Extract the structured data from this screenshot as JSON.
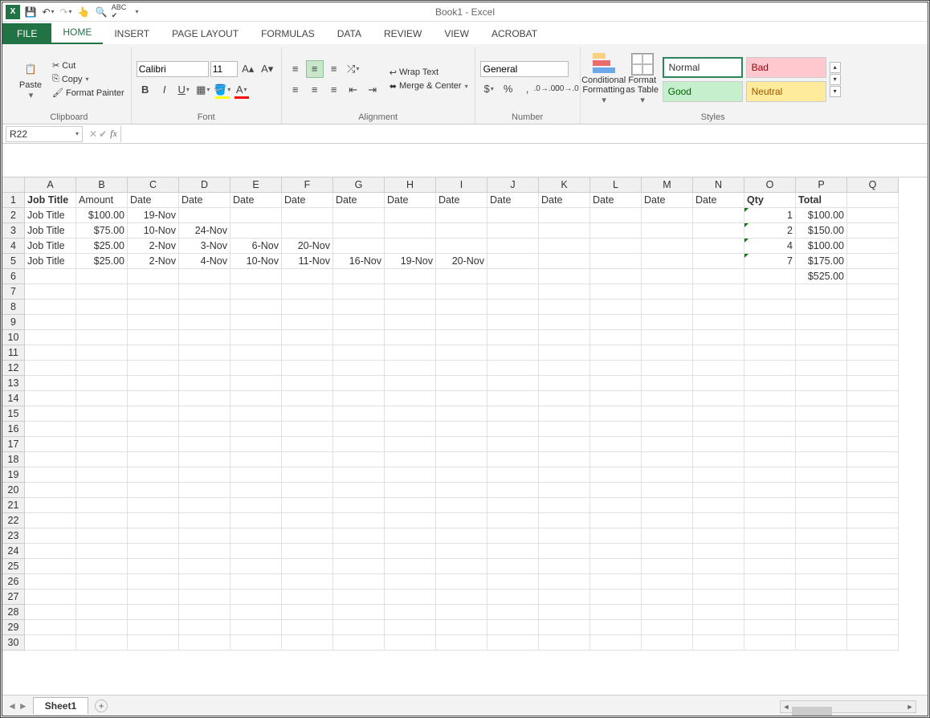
{
  "title": "Book1 - Excel",
  "tabs": {
    "file": "FILE",
    "home": "HOME",
    "insert": "INSERT",
    "pagelayout": "PAGE LAYOUT",
    "formulas": "FORMULAS",
    "data": "DATA",
    "review": "REVIEW",
    "view": "VIEW",
    "acrobat": "ACROBAT"
  },
  "ribbon": {
    "clipboard": {
      "paste": "Paste",
      "cut": "Cut",
      "copy": "Copy",
      "painter": "Format Painter",
      "label": "Clipboard"
    },
    "font": {
      "name": "Calibri",
      "size": "11",
      "label": "Font"
    },
    "alignment": {
      "wrap": "Wrap Text",
      "merge": "Merge & Center",
      "label": "Alignment"
    },
    "number": {
      "format": "General",
      "label": "Number"
    },
    "styles": {
      "cf": "Conditional Formatting",
      "fat": "Format as Table",
      "normal": "Normal",
      "bad": "Bad",
      "good": "Good",
      "neutral": "Neutral",
      "label": "Styles"
    }
  },
  "namebox": "R22",
  "columns": [
    "A",
    "B",
    "C",
    "D",
    "E",
    "F",
    "G",
    "H",
    "I",
    "J",
    "K",
    "L",
    "M",
    "N",
    "O",
    "P",
    "Q"
  ],
  "rows_shown": 30,
  "sheet": "Sheet1",
  "data": {
    "1": {
      "A": {
        "v": "Job Title",
        "b": true
      },
      "B": {
        "v": "Amount"
      },
      "C": {
        "v": "Date"
      },
      "D": {
        "v": "Date"
      },
      "E": {
        "v": "Date"
      },
      "F": {
        "v": "Date"
      },
      "G": {
        "v": "Date"
      },
      "H": {
        "v": "Date"
      },
      "I": {
        "v": "Date"
      },
      "J": {
        "v": "Date"
      },
      "K": {
        "v": "Date"
      },
      "L": {
        "v": "Date"
      },
      "M": {
        "v": "Date"
      },
      "N": {
        "v": "Date"
      },
      "O": {
        "v": "Qty",
        "b": true
      },
      "P": {
        "v": "Total",
        "b": true
      }
    },
    "2": {
      "A": {
        "v": "Job Title"
      },
      "B": {
        "v": "$100.00",
        "r": true
      },
      "C": {
        "v": "19-Nov",
        "r": true
      },
      "O": {
        "v": "1",
        "r": true,
        "gt": true
      },
      "P": {
        "v": "$100.00",
        "r": true
      }
    },
    "3": {
      "A": {
        "v": "Job Title"
      },
      "B": {
        "v": "$75.00",
        "r": true
      },
      "C": {
        "v": "10-Nov",
        "r": true
      },
      "D": {
        "v": "24-Nov",
        "r": true
      },
      "O": {
        "v": "2",
        "r": true,
        "gt": true
      },
      "P": {
        "v": "$150.00",
        "r": true
      }
    },
    "4": {
      "A": {
        "v": "Job Title"
      },
      "B": {
        "v": "$25.00",
        "r": true
      },
      "C": {
        "v": "2-Nov",
        "r": true
      },
      "D": {
        "v": "3-Nov",
        "r": true
      },
      "E": {
        "v": "6-Nov",
        "r": true
      },
      "F": {
        "v": "20-Nov",
        "r": true
      },
      "O": {
        "v": "4",
        "r": true,
        "gt": true
      },
      "P": {
        "v": "$100.00",
        "r": true
      }
    },
    "5": {
      "A": {
        "v": "Job Title"
      },
      "B": {
        "v": "$25.00",
        "r": true
      },
      "C": {
        "v": "2-Nov",
        "r": true
      },
      "D": {
        "v": "4-Nov",
        "r": true
      },
      "E": {
        "v": "10-Nov",
        "r": true
      },
      "F": {
        "v": "11-Nov",
        "r": true
      },
      "G": {
        "v": "16-Nov",
        "r": true
      },
      "H": {
        "v": "19-Nov",
        "r": true
      },
      "I": {
        "v": "20-Nov",
        "r": true
      },
      "O": {
        "v": "7",
        "r": true,
        "gt": true
      },
      "P": {
        "v": "$175.00",
        "r": true
      }
    },
    "6": {
      "P": {
        "v": "$525.00",
        "r": true
      }
    }
  }
}
